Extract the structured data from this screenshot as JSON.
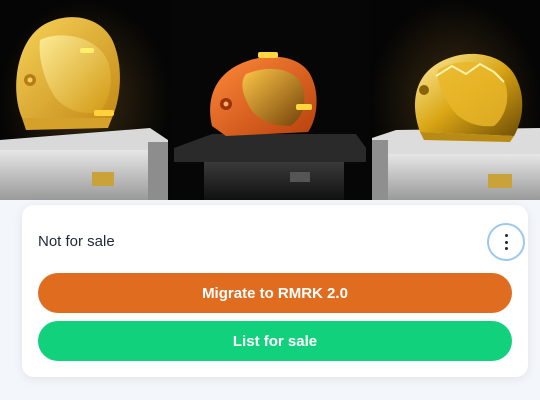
{
  "gallery": {
    "images": [
      {
        "subject": "yellow-space-helmet",
        "color": "#e9b82c"
      },
      {
        "subject": "orange-space-helmet",
        "color": "#e2661a"
      },
      {
        "subject": "gold-ornate-helmet",
        "color": "#c99a1c"
      }
    ]
  },
  "card": {
    "status_text": "Not for sale",
    "more_icon": "vertical-dots-icon"
  },
  "actions": {
    "migrate_label": "Migrate to RMRK 2.0",
    "list_label": "List for sale"
  },
  "colors": {
    "migrate_button": "#e06c1f",
    "list_button": "#12d17c",
    "focus_ring": "#9cc8ee"
  }
}
